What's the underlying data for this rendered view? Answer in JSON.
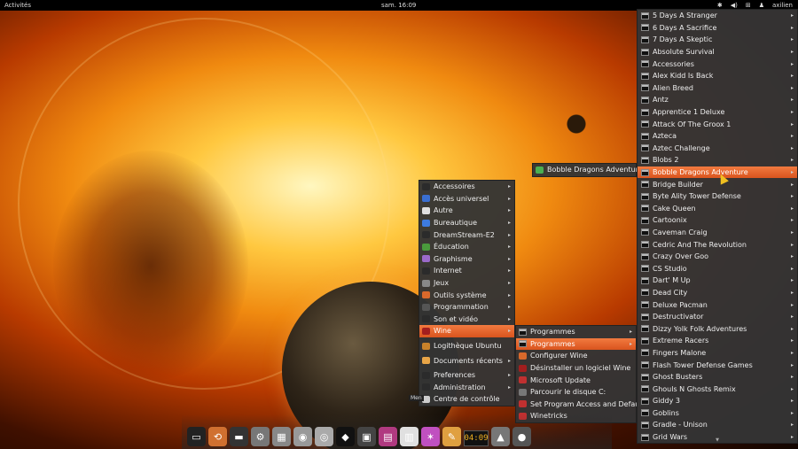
{
  "topbar": {
    "activities": "Activités",
    "clock": "sam. 16:09",
    "user": "axilien"
  },
  "main_menu": {
    "items": [
      {
        "label": "Accessoires",
        "arrow": true,
        "color": "#2b2b2b"
      },
      {
        "label": "Accès universel",
        "arrow": true,
        "color": "#3a6fd1"
      },
      {
        "label": "Autre",
        "arrow": true,
        "color": "#e0e0e0"
      },
      {
        "label": "Bureautique",
        "arrow": true,
        "color": "#3d7be0"
      },
      {
        "label": "DreamStream-E2",
        "arrow": true,
        "color": "#2b2b2b"
      },
      {
        "label": "Éducation",
        "arrow": true,
        "color": "#4a9a3c"
      },
      {
        "label": "Graphisme",
        "arrow": true,
        "color": "#9b6ac9"
      },
      {
        "label": "Internet",
        "arrow": true,
        "color": "#2b2b2b"
      },
      {
        "label": "Jeux",
        "arrow": true,
        "color": "#888888"
      },
      {
        "label": "Outils système",
        "arrow": true,
        "color": "#d9692b"
      },
      {
        "label": "Programmation",
        "arrow": true,
        "color": "#555555"
      },
      {
        "label": "Son et vidéo",
        "arrow": true,
        "color": "#2b2b2b"
      },
      {
        "label": "Wine",
        "arrow": true,
        "color": "#a31e1e",
        "highlight": true
      },
      {
        "label": "Logithèque Ubuntu",
        "arrow": false,
        "color": "#c7812a"
      },
      {
        "label": "Documents récents",
        "arrow": true,
        "color": "#e8a547"
      },
      {
        "label": "Preferences",
        "arrow": true,
        "color": "#2b2b2b"
      },
      {
        "label": "Administration",
        "arrow": true,
        "color": "#2b2b2b"
      },
      {
        "label": "Centre de contrôle",
        "arrow": false,
        "color": "#cccccc"
      }
    ]
  },
  "wine_menu": {
    "items": [
      {
        "label": "Programmes",
        "arrow": true,
        "color": "#2b2b2b"
      },
      {
        "label": "Programmes",
        "arrow": true,
        "color": "#2b2b2b",
        "highlight": true
      },
      {
        "label": "Configurer Wine",
        "arrow": false,
        "color": "#d9692b"
      },
      {
        "label": "Désinstaller un logiciel Wine",
        "arrow": false,
        "color": "#a31e1e"
      },
      {
        "label": "Microsoft Update",
        "arrow": false,
        "color": "#c03030"
      },
      {
        "label": "Parcourir le disque C:",
        "arrow": false,
        "color": "#777777"
      },
      {
        "label": "Set Program Access and Defaults",
        "arrow": false,
        "color": "#c03030"
      },
      {
        "label": "Winetricks",
        "arrow": false,
        "color": "#c03030"
      }
    ]
  },
  "bobble_menu": {
    "label": "Bobble Dragons Adventure",
    "color": "#4caf50"
  },
  "game_list": {
    "items": [
      "5 Days A Stranger",
      "6 Days A Sacrifice",
      "7 Days A Skeptic",
      "Absolute Survival",
      "Accessories",
      "Alex Kidd Is Back",
      "Alien Breed",
      "Antz",
      "Apprentice 1 Deluxe",
      "Attack Of The Groox 1",
      "Azteca",
      "Aztec Challenge",
      "Blobs 2",
      "Bobble Dragons Adventure",
      "Bridge Builder",
      "Byte Ality Tower Defense",
      "Cake Queen",
      "Cartoonix",
      "Caveman Craig",
      "Cedric And The Revolution",
      "Crazy Over Goo",
      "CS Studio",
      "Dart' M Up",
      "Dead City",
      "Deluxe Pacman",
      "Destructivator",
      "Dizzy Yolk Folk Adventures",
      "Extreme Racers",
      "Fingers Malone",
      "Flash Tower Defense Games",
      "Ghost Busters",
      "Ghouls N Ghosts Remix",
      "Giddy 3",
      "Goblins",
      "Gradle - Unison",
      "Grid Wars"
    ],
    "highlight_index": 13
  },
  "dock": {
    "tooltip": "Men",
    "clock": "04:09",
    "apps": [
      {
        "name": "terminal",
        "color": "#222222",
        "glyph": "▭"
      },
      {
        "name": "share",
        "color": "#d07030",
        "glyph": "⟲"
      },
      {
        "name": "window",
        "color": "#333333",
        "glyph": "▬"
      },
      {
        "name": "settings",
        "color": "#777777",
        "glyph": "⚙"
      },
      {
        "name": "calculator",
        "color": "#888888",
        "glyph": "▦"
      },
      {
        "name": "browser",
        "color": "#999999",
        "glyph": "◉"
      },
      {
        "name": "network",
        "color": "#aaaaaa",
        "glyph": "◎"
      },
      {
        "name": "tux",
        "color": "#111111",
        "glyph": "◆"
      },
      {
        "name": "monitor",
        "color": "#444444",
        "glyph": "▣"
      },
      {
        "name": "image-viewer",
        "color": "#b03a80",
        "glyph": "▤"
      },
      {
        "name": "documents",
        "color": "#e0e0e0",
        "glyph": "▥"
      },
      {
        "name": "star",
        "color": "#c050c0",
        "glyph": "✶"
      },
      {
        "name": "paint",
        "color": "#e0a040",
        "glyph": "✎"
      },
      {
        "name": "media",
        "color": "#777777",
        "glyph": "▲"
      },
      {
        "name": "disc",
        "color": "#555555",
        "glyph": "●"
      }
    ]
  }
}
